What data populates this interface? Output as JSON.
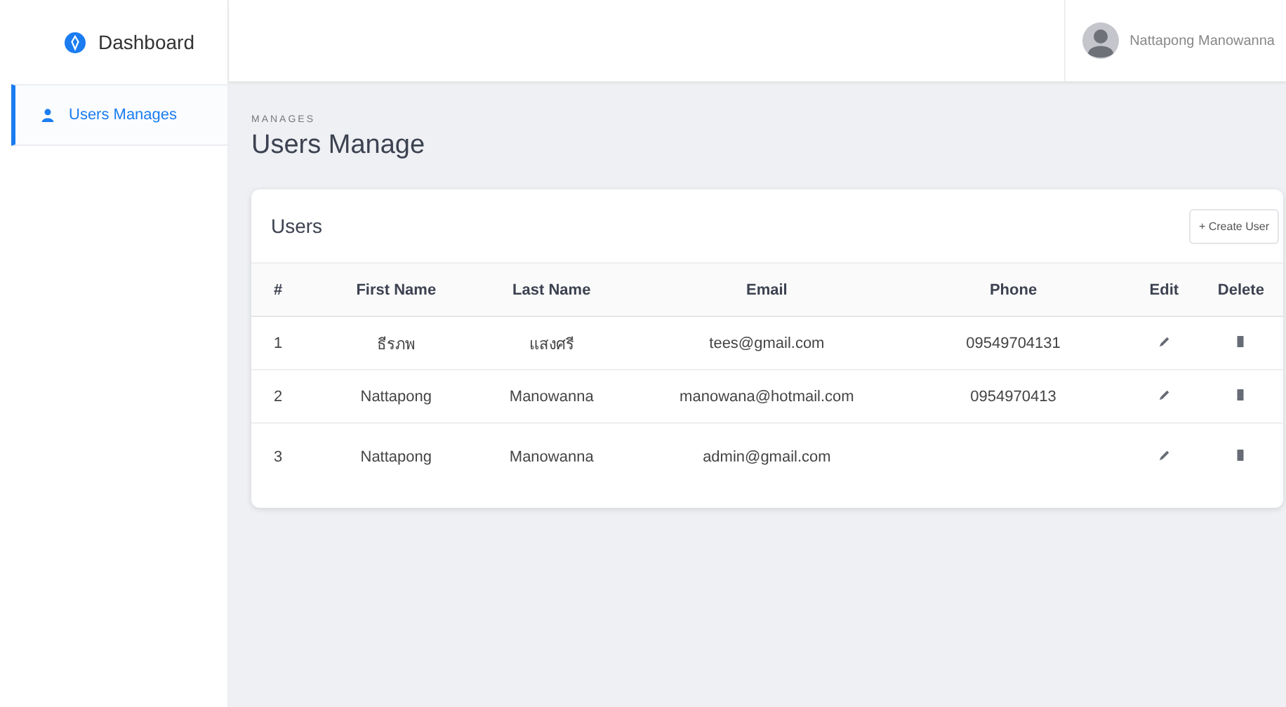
{
  "sidebar": {
    "brand": "Dashboard",
    "items": [
      {
        "label": "Users Manages",
        "selected": true
      }
    ]
  },
  "topbar": {
    "user_name": "Nattapong Manowanna"
  },
  "page": {
    "eyebrow": "MANAGES",
    "title": "Users Manage"
  },
  "card": {
    "title": "Users",
    "create_button": "+ Create User"
  },
  "table": {
    "columns": [
      "#",
      "First Name",
      "Last Name",
      "Email",
      "Phone",
      "Edit",
      "Delete"
    ],
    "rows": [
      {
        "index": "1",
        "first_name": "ธีรภพ",
        "last_name": "แสงศรี",
        "email": "tees@gmail.com",
        "phone": "09549704131"
      },
      {
        "index": "2",
        "first_name": "Nattapong",
        "last_name": "Manowanna",
        "email": "manowana@hotmail.com",
        "phone": "0954970413"
      },
      {
        "index": "3",
        "first_name": "Nattapong",
        "last_name": "Manowanna",
        "email": "admin@gmail.com"
      }
    ]
  }
}
